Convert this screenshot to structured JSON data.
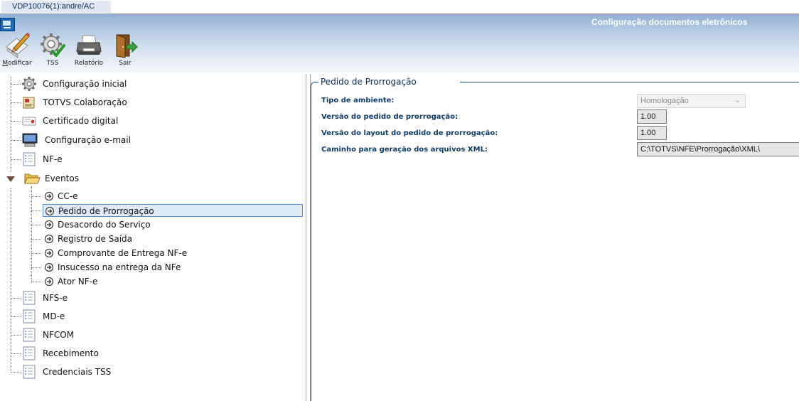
{
  "tab": {
    "label": "VDP10076(1):andre/AC"
  },
  "header": {
    "title": "Configuração documentos eletrônicos"
  },
  "toolbar": [
    {
      "label_first": "M",
      "label_rest": "odificar",
      "icon": "edit-icon"
    },
    {
      "label_first": "",
      "label_rest": "TSS",
      "icon": "gear-check-icon"
    },
    {
      "label_first": "",
      "label_rest": "Relatório",
      "icon": "printer-icon"
    },
    {
      "label_first": "",
      "label_rest": "Sair",
      "icon": "exit-door-icon"
    }
  ],
  "tree": {
    "items": [
      {
        "label": "Configuração inicial",
        "icon": "gear-icon"
      },
      {
        "label": "TOTVS Colaboração",
        "icon": "document-icon"
      },
      {
        "label": "Certificado digital",
        "icon": "certificate-icon"
      },
      {
        "label": "Configuração e-mail",
        "icon": "computer-icon"
      },
      {
        "label": "NF-e",
        "icon": "list-icon"
      },
      {
        "label": "Eventos",
        "icon": "folder-open-icon"
      },
      {
        "label": "NFS-e",
        "icon": "list-icon"
      },
      {
        "label": "MD-e",
        "icon": "list-icon"
      },
      {
        "label": "NFCOM",
        "icon": "list-icon"
      },
      {
        "label": "Recebimento",
        "icon": "list-icon"
      },
      {
        "label": "Credenciais TSS",
        "icon": "list-icon"
      }
    ],
    "events": [
      {
        "label": "CC-e",
        "selected": false
      },
      {
        "label": "Pedido de Prorrogação",
        "selected": true
      },
      {
        "label": "Desacordo do Serviço",
        "selected": false
      },
      {
        "label": "Registro de Saída",
        "selected": false
      },
      {
        "label": "Comprovante de Entrega NF-e",
        "selected": false
      },
      {
        "label": "Insucesso na entrega da NFe",
        "selected": false
      },
      {
        "label": "Ator NF-e",
        "selected": false
      }
    ]
  },
  "form": {
    "section_title": "Pedido de Prorrogação",
    "tipo_ambiente": {
      "label": "Tipo de ambiente:",
      "value": "Homologação"
    },
    "versao_pedido": {
      "label": "Versão do pedido de prorrogação:",
      "value": "1.00"
    },
    "versao_layout": {
      "label": "Versão do layout do pedido de prorrogação:",
      "value": "1.00"
    },
    "caminho_xml": {
      "label": "Caminho para geração dos arquivos XML:",
      "value": "C:\\TOTVS\\NFE\\Prorrogação\\XML\\"
    }
  }
}
